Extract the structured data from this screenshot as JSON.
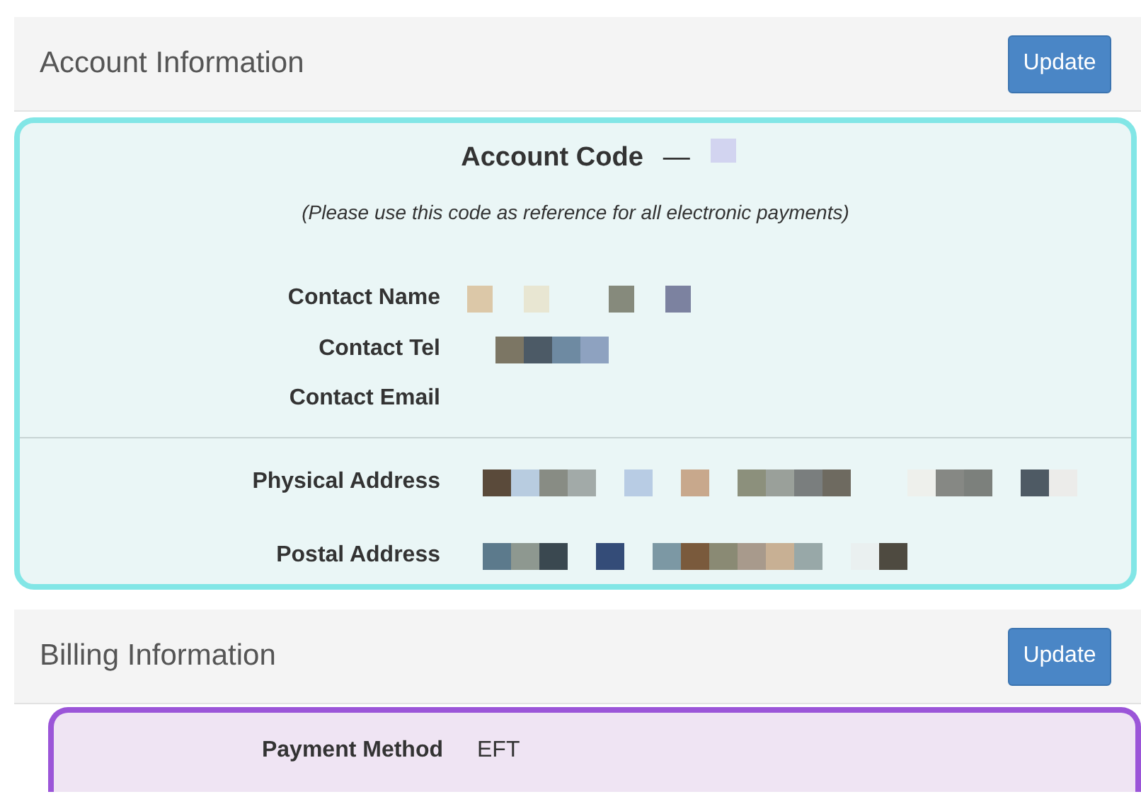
{
  "account_information": {
    "title": "Account Information",
    "update_button": "Update",
    "account_code_label": "Account Code",
    "account_code_value": "—",
    "note": "(Please use this code as reference for all electronic payments)",
    "contacts": [
      {
        "label": "Contact Name",
        "value_redacted": true
      },
      {
        "label": "Contact Tel",
        "value_redacted": true
      },
      {
        "label": "Contact Email",
        "value_redacted": false
      }
    ],
    "addresses": [
      {
        "label": "Physical Address",
        "value_redacted": true
      },
      {
        "label": "Postal Address",
        "value_redacted": true
      }
    ]
  },
  "billing_information": {
    "title": "Billing Information",
    "update_button": "Update",
    "rows": [
      {
        "label": "Payment Method",
        "value": "EFT"
      }
    ]
  }
}
